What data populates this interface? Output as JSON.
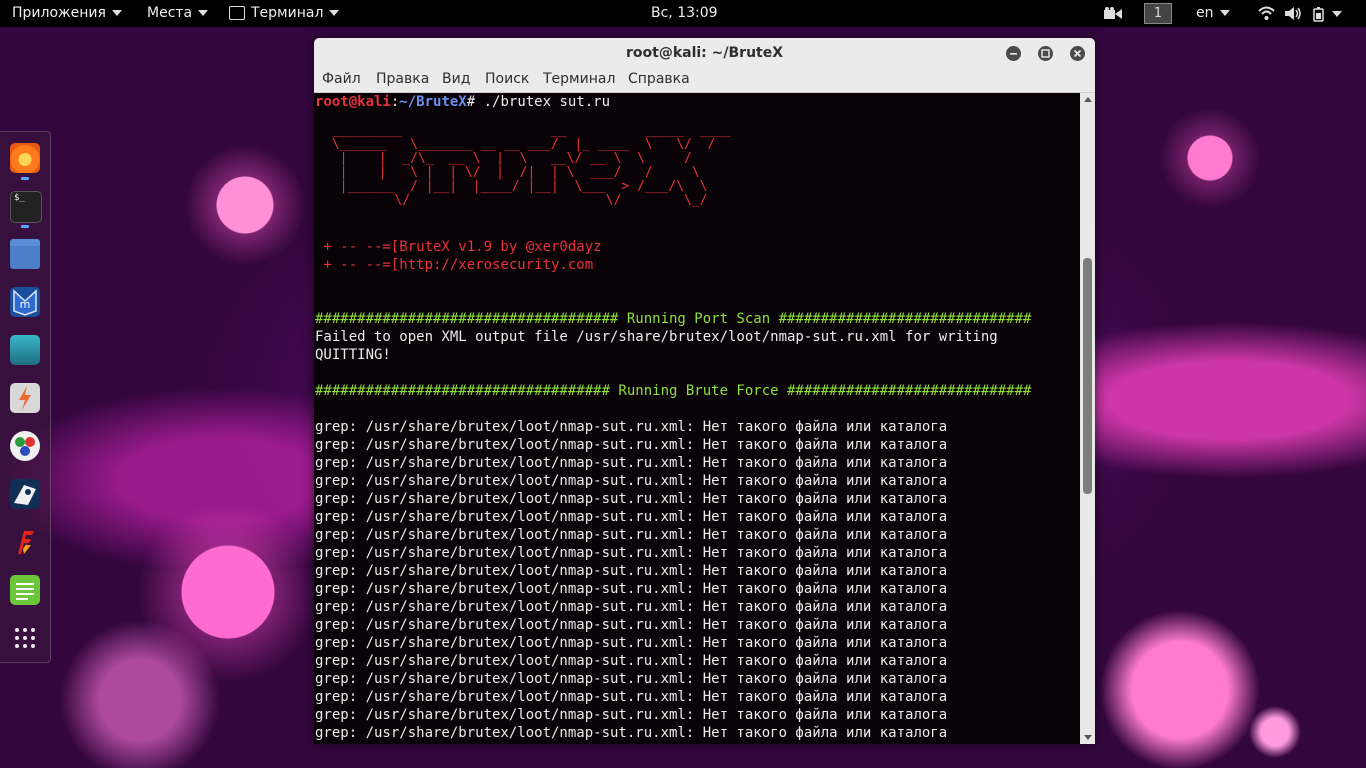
{
  "topbar": {
    "applications": "Приложения",
    "places": "Места",
    "terminal": "Терминал",
    "clock": "Вс, 13:09",
    "workspace": "1",
    "keyboard": "en"
  },
  "dock": {
    "items": [
      "firefox-icon",
      "terminal-icon",
      "files-icon",
      "metasploit-icon",
      "armitage-icon",
      "burpsuite-icon",
      "maltego-icon",
      "beef-icon",
      "faraday-icon",
      "leafpad-icon",
      "show-apps-icon"
    ]
  },
  "window": {
    "title": "root@kali: ~/BruteX",
    "menu": [
      "Файл",
      "Правка",
      "Вид",
      "Поиск",
      "Терминал",
      "Справка"
    ]
  },
  "terminal": {
    "prompt_user": "root@kali",
    "prompt_sep": ":",
    "prompt_path": "~/BruteX",
    "prompt_end": "#",
    "command": " ./brutex sut.ru",
    "banner_ascii": " _________                   __          _____  ____\n \\______   \\_______ __ __ ___/  |_ ____  \\   \\/  /\n  |    |  _/\\_  __ \\  |  \\   __\\/ __ \\  \\     /\n  |    |   \\ |  | \\/  |  /|  | \\  ___/   /     \\\n  |______  / |__|  |____/ |__|  \\___  > /___/\\  \\\n         \\/                         \\/        \\_/",
    "banner_line1": " + -- --=[BruteX v1.9 by @xer0dayz",
    "banner_line2": " + -- --=[http://xerosecurity.com",
    "port_scan_header": "#################################### Running Port Scan ##############################",
    "fail_line": "Failed to open XML output file /usr/share/brutex/loot/nmap-sut.ru.xml for writing",
    "quit_line": "QUITTING!",
    "brute_header": "################################### Running Brute Force #############################",
    "grep_lines": [
      "grep: /usr/share/brutex/loot/nmap-sut.ru.xml: Нет такого файла или каталога",
      "grep: /usr/share/brutex/loot/nmap-sut.ru.xml: Нет такого файла или каталога",
      "grep: /usr/share/brutex/loot/nmap-sut.ru.xml: Нет такого файла или каталога",
      "grep: /usr/share/brutex/loot/nmap-sut.ru.xml: Нет такого файла или каталога",
      "grep: /usr/share/brutex/loot/nmap-sut.ru.xml: Нет такого файла или каталога",
      "grep: /usr/share/brutex/loot/nmap-sut.ru.xml: Нет такого файла или каталога",
      "grep: /usr/share/brutex/loot/nmap-sut.ru.xml: Нет такого файла или каталога",
      "grep: /usr/share/brutex/loot/nmap-sut.ru.xml: Нет такого файла или каталога",
      "grep: /usr/share/brutex/loot/nmap-sut.ru.xml: Нет такого файла или каталога",
      "grep: /usr/share/brutex/loot/nmap-sut.ru.xml: Нет такого файла или каталога",
      "grep: /usr/share/brutex/loot/nmap-sut.ru.xml: Нет такого файла или каталога",
      "grep: /usr/share/brutex/loot/nmap-sut.ru.xml: Нет такого файла или каталога",
      "grep: /usr/share/brutex/loot/nmap-sut.ru.xml: Нет такого файла или каталога",
      "grep: /usr/share/brutex/loot/nmap-sut.ru.xml: Нет такого файла или каталога",
      "grep: /usr/share/brutex/loot/nmap-sut.ru.xml: Нет такого файла или каталога",
      "grep: /usr/share/brutex/loot/nmap-sut.ru.xml: Нет такого файла или каталога",
      "grep: /usr/share/brutex/loot/nmap-sut.ru.xml: Нет такого файла или каталога",
      "grep: /usr/share/brutex/loot/nmap-sut.ru.xml: Нет такого файла или каталога"
    ]
  },
  "colors": {
    "prompt_red": "#e6323a",
    "prompt_blue": "#6d8ff0",
    "header_green": "#8ee03a"
  }
}
